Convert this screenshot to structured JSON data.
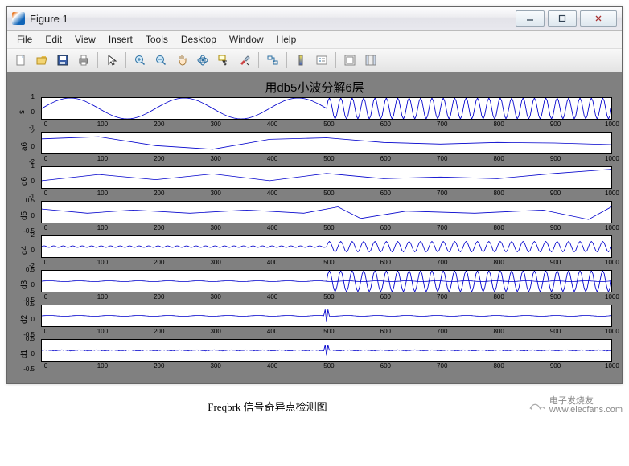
{
  "window": {
    "title": "Figure 1",
    "min_tip": "Minimize",
    "max_tip": "Maximize",
    "close_tip": "Close"
  },
  "menu": {
    "items": [
      "File",
      "Edit",
      "View",
      "Insert",
      "Tools",
      "Desktop",
      "Window",
      "Help"
    ]
  },
  "toolbar": {
    "buttons": [
      {
        "name": "new-figure-icon"
      },
      {
        "name": "open-icon"
      },
      {
        "name": "save-icon"
      },
      {
        "name": "print-icon"
      },
      {
        "sep": true
      },
      {
        "name": "pointer-icon"
      },
      {
        "sep": true
      },
      {
        "name": "zoom-in-icon"
      },
      {
        "name": "zoom-out-icon"
      },
      {
        "name": "pan-icon"
      },
      {
        "name": "rotate3d-icon"
      },
      {
        "name": "datacursor-icon"
      },
      {
        "name": "brush-icon"
      },
      {
        "sep": true
      },
      {
        "name": "link-icon"
      },
      {
        "sep": true
      },
      {
        "name": "colorbar-icon"
      },
      {
        "name": "legend-icon"
      },
      {
        "sep": true
      },
      {
        "name": "hide-plot-tools-icon"
      },
      {
        "name": "show-plot-tools-icon"
      }
    ]
  },
  "figure": {
    "title": "用db5小波分解6层",
    "xticks": [
      0,
      100,
      200,
      300,
      400,
      500,
      600,
      700,
      800,
      900,
      1000
    ],
    "subplots": [
      {
        "ylabel": "s",
        "ylim": [
          -1,
          1
        ],
        "yticks": [
          -1,
          0,
          1
        ]
      },
      {
        "ylabel": "a6",
        "ylim": [
          -2,
          2
        ],
        "yticks": [
          -2,
          0,
          2
        ]
      },
      {
        "ylabel": "d6",
        "ylim": [
          -1,
          1
        ],
        "yticks": [
          -1,
          0,
          1
        ]
      },
      {
        "ylabel": "d5",
        "ylim": [
          -0.5,
          0.5
        ],
        "yticks": [
          -0.5,
          0,
          0.5
        ]
      },
      {
        "ylabel": "d4",
        "ylim": [
          -2,
          2
        ],
        "yticks": [
          -2,
          0,
          2
        ]
      },
      {
        "ylabel": "d3",
        "ylim": [
          -0.5,
          0.5
        ],
        "yticks": [
          -0.5,
          0,
          0.5
        ]
      },
      {
        "ylabel": "d2",
        "ylim": [
          -0.5,
          0.5
        ],
        "yticks": [
          -0.5,
          0,
          0.5
        ]
      },
      {
        "ylabel": "d1",
        "ylim": [
          -0.5,
          0.5
        ],
        "yticks": [
          -0.5,
          0,
          0.5
        ]
      }
    ]
  },
  "caption": "Freqbrk 信号奇异点检测图",
  "watermark": {
    "line1": "电子发烧友",
    "line2": "www.elecfans.com"
  },
  "chart_data": {
    "type": "line",
    "title": "用db5小波分解6层",
    "xlabel": "",
    "x_range": [
      0,
      1000
    ],
    "description": "8 stacked subplots: top is original signal s composed of a low-frequency sine for x<500 and a high-frequency sine for x>=500. a6 is the level-6 approximation showing the slow sinusoidal trend. d6..d1 are detail coefficients; d4 and d3 show strong high-frequency oscillation for x>500 and small amplitude elsewhere; d2 and d1 are near zero except a spike near x=500.",
    "series": [
      {
        "name": "s",
        "ylim": [
          -1,
          1
        ],
        "segments": [
          {
            "xfrom": 0,
            "xto": 500,
            "form": "sin",
            "freq_cycles": 2.5,
            "amplitude": 1.0
          },
          {
            "xfrom": 500,
            "xto": 1000,
            "form": "sin",
            "freq_cycles": 25,
            "amplitude": 1.0
          }
        ]
      },
      {
        "name": "a6",
        "ylim": [
          -2,
          2
        ],
        "approx_points": [
          {
            "x": 0,
            "y": 0.8
          },
          {
            "x": 100,
            "y": 1.2
          },
          {
            "x": 200,
            "y": -0.5
          },
          {
            "x": 300,
            "y": -1.2
          },
          {
            "x": 400,
            "y": 0.7
          },
          {
            "x": 500,
            "y": 1.0
          },
          {
            "x": 600,
            "y": 0.1
          },
          {
            "x": 700,
            "y": -0.2
          },
          {
            "x": 800,
            "y": 0.1
          },
          {
            "x": 900,
            "y": 0.0
          },
          {
            "x": 1000,
            "y": -0.3
          }
        ]
      },
      {
        "name": "d6",
        "ylim": [
          -1,
          1
        ],
        "approx_points": [
          {
            "x": 0,
            "y": -0.3
          },
          {
            "x": 100,
            "y": 0.3
          },
          {
            "x": 200,
            "y": -0.2
          },
          {
            "x": 300,
            "y": 0.35
          },
          {
            "x": 400,
            "y": -0.3
          },
          {
            "x": 500,
            "y": 0.4
          },
          {
            "x": 600,
            "y": -0.1
          },
          {
            "x": 700,
            "y": 0.05
          },
          {
            "x": 800,
            "y": -0.1
          },
          {
            "x": 900,
            "y": 0.4
          },
          {
            "x": 1000,
            "y": 0.8
          }
        ]
      },
      {
        "name": "d5",
        "ylim": [
          -0.5,
          0.5
        ],
        "approx_points": [
          {
            "x": 0,
            "y": 0.15
          },
          {
            "x": 80,
            "y": -0.05
          },
          {
            "x": 160,
            "y": 0.1
          },
          {
            "x": 260,
            "y": -0.05
          },
          {
            "x": 360,
            "y": 0.1
          },
          {
            "x": 460,
            "y": -0.05
          },
          {
            "x": 520,
            "y": 0.25
          },
          {
            "x": 560,
            "y": -0.3
          },
          {
            "x": 640,
            "y": 0.05
          },
          {
            "x": 760,
            "y": -0.05
          },
          {
            "x": 880,
            "y": 0.1
          },
          {
            "x": 960,
            "y": -0.35
          },
          {
            "x": 1000,
            "y": 0.25
          }
        ]
      },
      {
        "name": "d4",
        "ylim": [
          -2,
          2
        ],
        "segments": [
          {
            "xfrom": 0,
            "xto": 500,
            "form": "sin",
            "freq_cycles": 30,
            "amplitude": 0.15
          },
          {
            "xfrom": 500,
            "xto": 1000,
            "form": "sin",
            "freq_cycles": 25,
            "amplitude": 1.0
          }
        ]
      },
      {
        "name": "d3",
        "ylim": [
          -0.5,
          0.5
        ],
        "segments": [
          {
            "xfrom": 0,
            "xto": 500,
            "form": "flat",
            "amplitude": 0.02
          },
          {
            "xfrom": 500,
            "xto": 1000,
            "form": "sin",
            "freq_cycles": 25,
            "amplitude": 0.5
          }
        ]
      },
      {
        "name": "d2",
        "ylim": [
          -0.5,
          0.5
        ],
        "segments": [
          {
            "xfrom": 0,
            "xto": 1000,
            "form": "flat",
            "amplitude": 0.02
          },
          {
            "spike_x": 500,
            "spike_y": 0.3
          }
        ]
      },
      {
        "name": "d1",
        "ylim": [
          -0.5,
          0.5
        ],
        "segments": [
          {
            "xfrom": 0,
            "xto": 1000,
            "form": "noise",
            "amplitude": 0.03
          },
          {
            "spike_x": 500,
            "spike_y": 0.25
          }
        ]
      }
    ]
  }
}
